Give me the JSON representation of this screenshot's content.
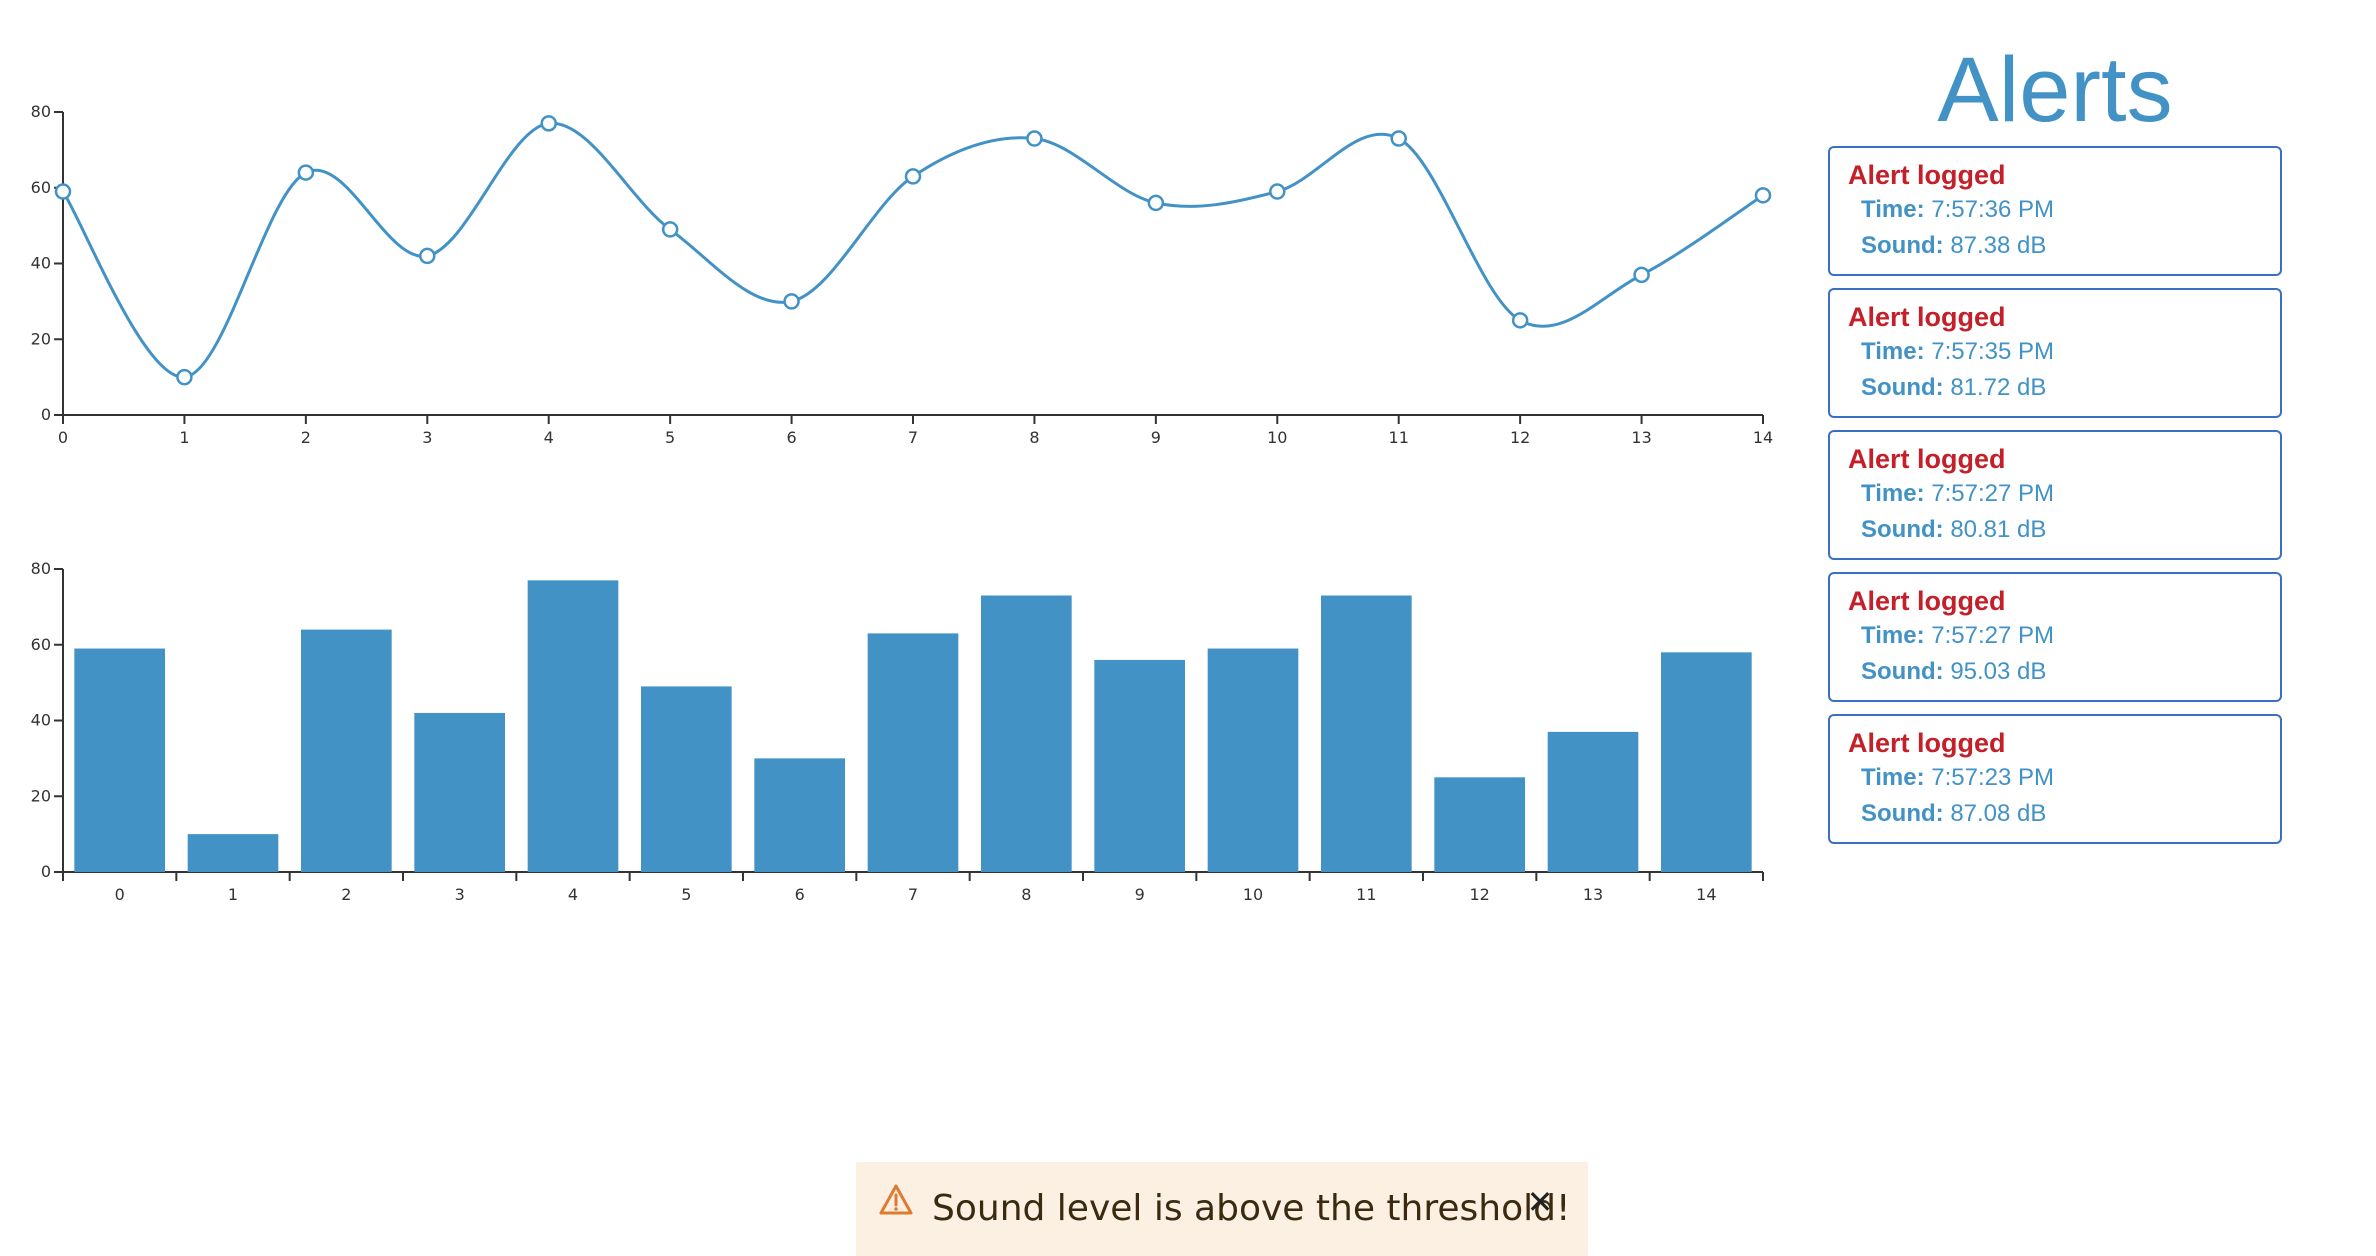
{
  "chart_data": [
    {
      "type": "line",
      "x": [
        0,
        1,
        2,
        3,
        4,
        5,
        6,
        7,
        8,
        9,
        10,
        11,
        12,
        13,
        14
      ],
      "values": [
        59,
        10,
        64,
        42,
        77,
        49,
        30,
        63,
        73,
        56,
        59,
        73,
        25,
        37,
        58
      ],
      "xlim": [
        0,
        14
      ],
      "ylim": [
        0,
        80
      ],
      "yticks": [
        0,
        20,
        40,
        60,
        80
      ],
      "curve": "smooth",
      "markers": "hollow circles",
      "color": "#4292c6",
      "grid": false
    },
    {
      "type": "bar",
      "categories": [
        "0",
        "1",
        "2",
        "3",
        "4",
        "5",
        "6",
        "7",
        "8",
        "9",
        "10",
        "11",
        "12",
        "13",
        "14"
      ],
      "values": [
        59,
        10,
        64,
        42,
        77,
        49,
        30,
        63,
        73,
        56,
        59,
        73,
        25,
        37,
        58
      ],
      "ylim": [
        0,
        80
      ],
      "yticks": [
        0,
        20,
        40,
        60,
        80
      ],
      "color": "#4292c6",
      "grid": false
    }
  ],
  "alerts": {
    "title": "Alerts",
    "heading_color": "#c3202a",
    "text_color": "#4292c6",
    "time_label": "Time:",
    "sound_label": "Sound:",
    "items": [
      {
        "heading": "Alert logged",
        "time": "7:57:36 PM",
        "sound": "87.38 dB"
      },
      {
        "heading": "Alert logged",
        "time": "7:57:35 PM",
        "sound": "81.72 dB"
      },
      {
        "heading": "Alert logged",
        "time": "7:57:27 PM",
        "sound": "80.81 dB"
      },
      {
        "heading": "Alert logged",
        "time": "7:57:27 PM",
        "sound": "95.03 dB"
      },
      {
        "heading": "Alert logged",
        "time": "7:57:23 PM",
        "sound": "87.08 dB"
      }
    ]
  },
  "toast": {
    "icon": "warning-icon",
    "message": "Sound level is above the threshold!",
    "close_icon": "close-icon",
    "close_glyph": "✕",
    "background": "#fcf0e2"
  }
}
